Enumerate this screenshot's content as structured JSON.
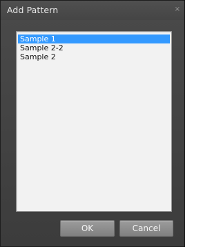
{
  "dialog": {
    "title": "Add Pattern",
    "close_glyph": "×"
  },
  "list": {
    "items": [
      {
        "label": "Sample 1",
        "selected": true
      },
      {
        "label": "Sample 2-2",
        "selected": false
      },
      {
        "label": "Sample 2",
        "selected": false
      }
    ]
  },
  "buttons": {
    "ok_label": "OK",
    "cancel_label": "Cancel"
  },
  "colors": {
    "selection": "#3399ff",
    "dialog_background": "#3c3c3c",
    "list_background": "#f2f2f2"
  }
}
